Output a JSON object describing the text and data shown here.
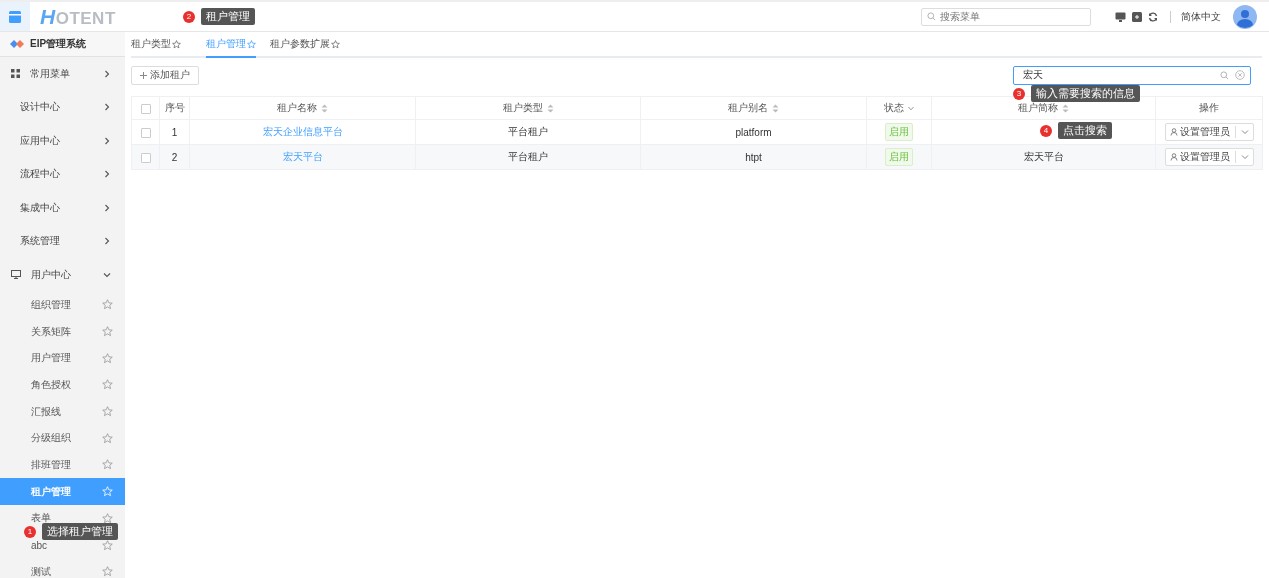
{
  "header": {
    "logo": "HOTENT",
    "search": {
      "placeholder": "搜索菜单"
    },
    "language": "简体中文"
  },
  "sidebar": {
    "title": "EIP管理系统",
    "items": [
      {
        "label": "常用菜单",
        "kind": "menu",
        "expanded": false
      },
      {
        "label": "设计中心",
        "kind": "group",
        "expanded": false
      },
      {
        "label": "应用中心",
        "kind": "group",
        "expanded": false
      },
      {
        "label": "流程中心",
        "kind": "group",
        "expanded": false
      },
      {
        "label": "集成中心",
        "kind": "group",
        "expanded": false
      },
      {
        "label": "系统管理",
        "kind": "group",
        "expanded": false
      },
      {
        "label": "用户中心",
        "kind": "monitor",
        "expanded": true,
        "children": [
          {
            "label": "组织管理",
            "selected": false
          },
          {
            "label": "关系矩阵",
            "selected": false
          },
          {
            "label": "用户管理",
            "selected": false
          },
          {
            "label": "角色授权",
            "selected": false
          },
          {
            "label": "汇报线",
            "selected": false
          },
          {
            "label": "分级组织",
            "selected": false
          },
          {
            "label": "排班管理",
            "selected": false
          },
          {
            "label": "租户管理",
            "selected": true
          },
          {
            "label": "表单",
            "selected": false
          },
          {
            "label": "abc",
            "selected": false
          },
          {
            "label": "测试",
            "selected": false
          }
        ]
      }
    ]
  },
  "tabs": [
    {
      "label": "租户类型",
      "selected": false
    },
    {
      "label": "租户管理",
      "selected": true
    },
    {
      "label": "租户参数扩展",
      "selected": false
    }
  ],
  "toolbar": {
    "add_button": "添加租户",
    "search": {
      "value": "宏天"
    }
  },
  "table": {
    "select_all_checked": false,
    "columns": [
      {
        "label": "序号",
        "sortable": false,
        "filter": false
      },
      {
        "label": "租户名称",
        "sortable": true,
        "filter": false
      },
      {
        "label": "租户类型",
        "sortable": true,
        "filter": false
      },
      {
        "label": "租户别名",
        "sortable": true,
        "filter": false
      },
      {
        "label": "状态",
        "sortable": false,
        "filter": true
      },
      {
        "label": "租户简称",
        "sortable": true,
        "filter": false
      },
      {
        "label": "操作",
        "sortable": false,
        "filter": false
      }
    ],
    "rows": [
      {
        "checked": false,
        "index": "1",
        "name": "宏天企业信息平台",
        "type": "平台租户",
        "alias": "platform",
        "status": "启用",
        "short_name": "",
        "action": "设置管理员"
      },
      {
        "checked": false,
        "index": "2",
        "name": "宏天平台",
        "type": "平台租户",
        "alias": "htpt",
        "status": "启用",
        "short_name": "宏天平台",
        "action": "设置管理员"
      }
    ]
  },
  "callouts": [
    {
      "number": "1",
      "text": "选择租户管理"
    },
    {
      "number": "2",
      "text": "租户管理"
    },
    {
      "number": "3",
      "text": "输入需要搜索的信息"
    },
    {
      "number": "4",
      "text": "点击搜索"
    }
  ]
}
